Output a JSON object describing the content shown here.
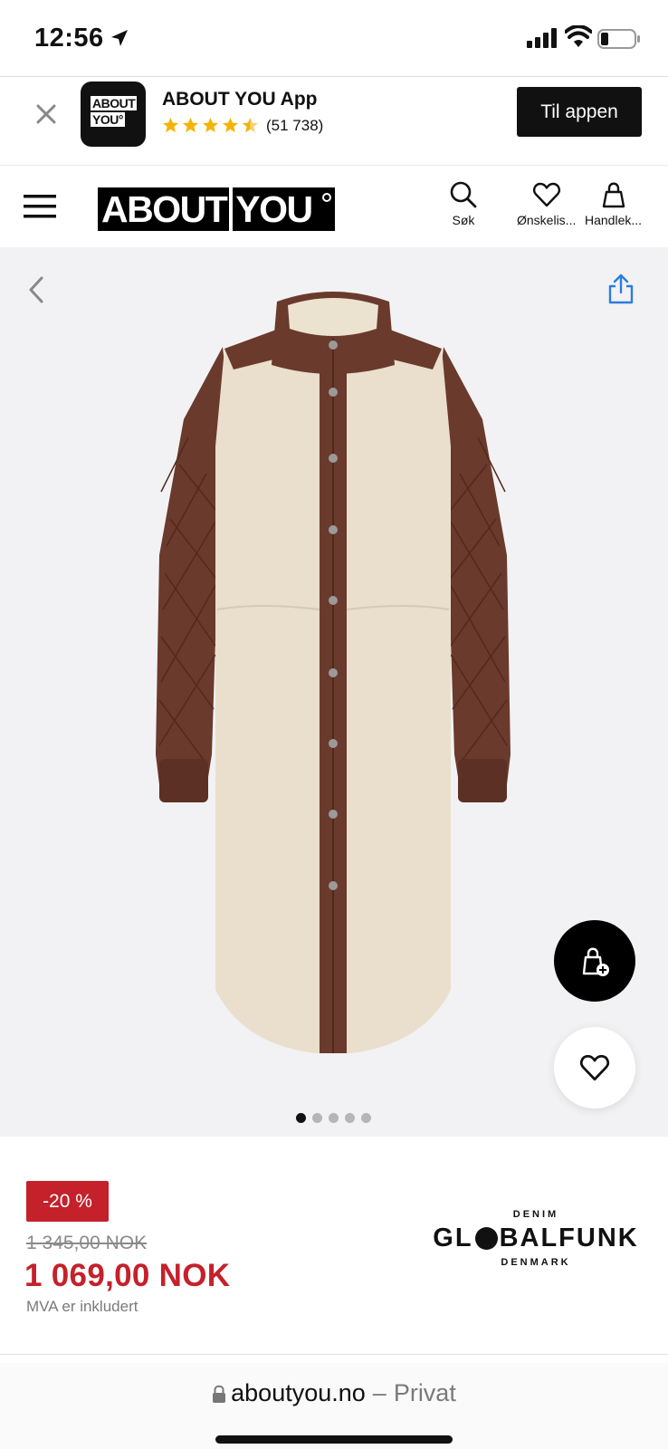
{
  "status_bar": {
    "time": "12:56"
  },
  "app_banner": {
    "icon_line1": "ABOUT",
    "icon_line2": "YOU°",
    "title": "ABOUT YOU App",
    "rating_stars": 4.5,
    "rating_count": "(51 738)",
    "open_button": "Til appen"
  },
  "header": {
    "logo_part1": "ABOUT",
    "logo_part2": "YOU",
    "nav": [
      {
        "label": "Søk",
        "icon": "search-icon"
      },
      {
        "label": "Ønskelis...",
        "icon": "heart-icon"
      },
      {
        "label": "Handlek...",
        "icon": "bag-icon"
      }
    ]
  },
  "gallery": {
    "image_count": 5,
    "active_index": 0
  },
  "product": {
    "discount_badge": "-20 %",
    "old_price": "1 345,00 NOK",
    "new_price": "1 069,00 NOK",
    "vat_note": "MVA er inkludert",
    "brand_top": "DENIM",
    "brand_main_left": "GL",
    "brand_main_right": "BALFUNK",
    "brand_bottom": "DENMARK"
  },
  "url_bar": {
    "domain": "aboutyou.no",
    "separator": "–",
    "mode": "Privat"
  },
  "colors": {
    "accent_red": "#c4212b",
    "star_yellow": "#f5b301",
    "black": "#111111",
    "link_blue": "#2a7de1"
  }
}
